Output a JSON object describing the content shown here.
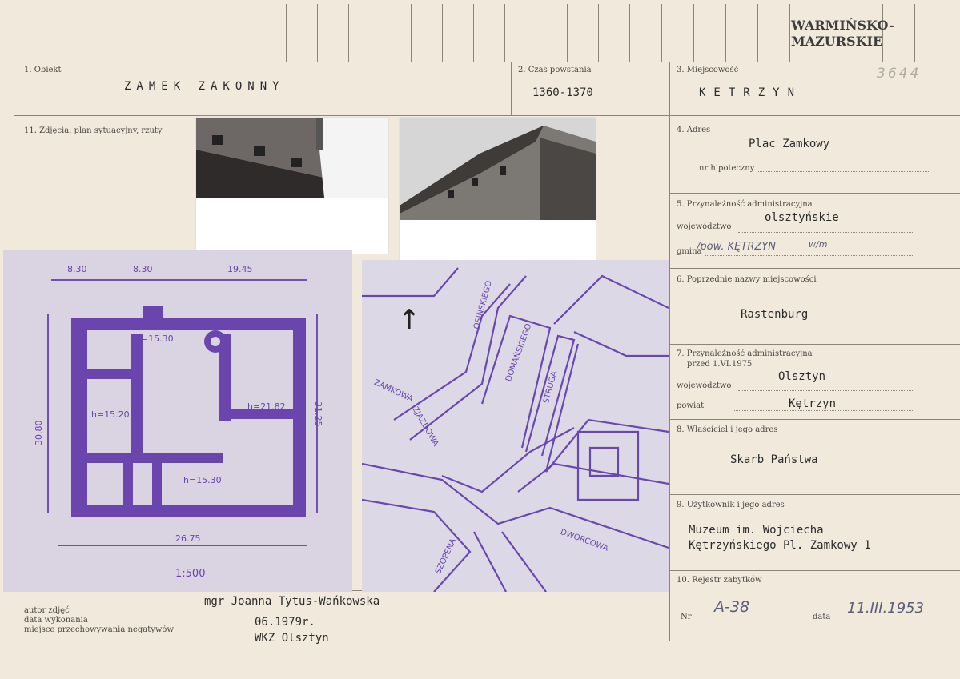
{
  "header": {
    "stamp_line1": "WARMIŃSKO-",
    "stamp_line2": "MAZURSKIE",
    "archive_number": "3644"
  },
  "fields": {
    "obiekt": {
      "label": "1. Obiekt",
      "value": "ZAMEK ZAKONNY"
    },
    "czas": {
      "label": "2. Czas powstania",
      "value": "1360-1370"
    },
    "miejscowosc": {
      "label": "3. Miejscowość",
      "value": "KETRZYN"
    },
    "zdjecia": {
      "label": "11. Zdjęcia, plan sytuacyjny, rzuty"
    },
    "adres": {
      "label": "4. Adres",
      "value": "Plac Zamkowy",
      "hipoteczny_label": "nr hipoteczny"
    },
    "przynaleznosc": {
      "label": "5. Przynależność administracyjna",
      "woj_label": "województwo",
      "woj_value": "olsztyńskie",
      "gmina_label": "gmina",
      "gmina_value": "/pow. KĘTRZYN",
      "gmina_extra": "w/m"
    },
    "poprzednie": {
      "label": "6. Poprzednie nazwy miejscowości",
      "value": "Rastenburg"
    },
    "przynaleznosc_1975": {
      "label_1": "7. Przynależność administracyjna",
      "label_2": "przed 1.VI.1975",
      "woj_label": "województwo",
      "woj_value": "Olsztyn",
      "powiat_label": "powiat",
      "powiat_value": "Kętrzyn"
    },
    "wlasciciel": {
      "label": "8. Właściciel i jego adres",
      "value": "Skarb Państwa"
    },
    "uzytkownik": {
      "label": "9. Użytkownik i jego adres",
      "value_1": "Muzeum im. Wojciecha",
      "value_2": "Kętrzyńskiego Pl. Zamkowy 1"
    },
    "rejestr": {
      "label": "10. Rejestr zabytków",
      "nr_label": "Nr",
      "nr_value": "A-38",
      "data_label": "data",
      "data_value": "11.III.1953"
    }
  },
  "footer": {
    "autor_label": "autor zdjęć",
    "data_label": "data wykonania",
    "miejsce_label": "miejsce przechowywania negatywów",
    "autor_value": "mgr Joanna Tytus-Wańkowska",
    "data_value": "06.1979r.",
    "miejsce_value": "WKZ Olsztyn"
  },
  "plan": {
    "dim_top": [
      "8.30",
      "8.30",
      "19.45"
    ],
    "dim_bottom": "26.75",
    "dim_left": "30.80",
    "dim_right": "31.25",
    "h_labels": [
      "h=15.30",
      "h=21.82",
      "h=15.20",
      "h=15.30"
    ],
    "scale": "1:500"
  },
  "map": {
    "streets": [
      "OSIŃSKIEGO",
      "DOMAŃSKIEGO",
      "STRUGA",
      "ZAMKOWA",
      "ZJAZDOWA",
      "SZOPENA",
      "DWORCOWA"
    ],
    "north": "↑"
  }
}
